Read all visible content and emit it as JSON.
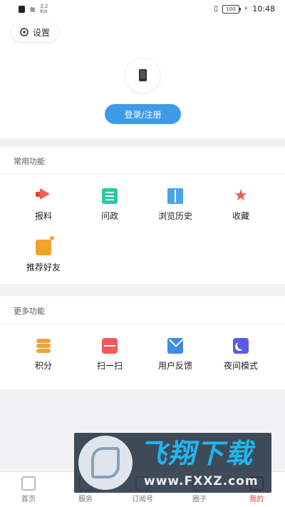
{
  "status_bar": {
    "speed": "3.2\nK/s",
    "time": "10:48",
    "battery": "100"
  },
  "top": {
    "settings_label": "设置",
    "login_label": "登录/注册"
  },
  "common": {
    "title": "常用功能",
    "items": [
      {
        "label": "报料",
        "icon": "megaphone-icon",
        "color": "#e8443a"
      },
      {
        "label": "问政",
        "icon": "list-icon",
        "color": "#2cc7a0"
      },
      {
        "label": "浏览历史",
        "icon": "book-icon",
        "color": "#4aa3e8"
      },
      {
        "label": "收藏",
        "icon": "star-icon",
        "color": "#f05a4a"
      },
      {
        "label": "推荐好友",
        "icon": "thumbs-up-icon",
        "color": "#f4a12a"
      }
    ]
  },
  "more": {
    "title": "更多功能",
    "items": [
      {
        "label": "积分",
        "icon": "coins-icon",
        "color": "#f0a23a"
      },
      {
        "label": "扫一扫",
        "icon": "scan-icon",
        "color": "#f05a5a"
      },
      {
        "label": "用户反馈",
        "icon": "mail-icon",
        "color": "#3d8be8"
      },
      {
        "label": "夜间模式",
        "icon": "moon-icon",
        "color": "#5a5be8"
      }
    ]
  },
  "nav": {
    "tabs": [
      {
        "label": "首页"
      },
      {
        "label": "服务"
      },
      {
        "label": "订阅号"
      },
      {
        "label": "圈子"
      },
      {
        "label": "我的"
      }
    ],
    "active_color": "#e84040"
  },
  "watermark": {
    "brand": "飞翔下载",
    "url": "www.FXXZ.com"
  }
}
